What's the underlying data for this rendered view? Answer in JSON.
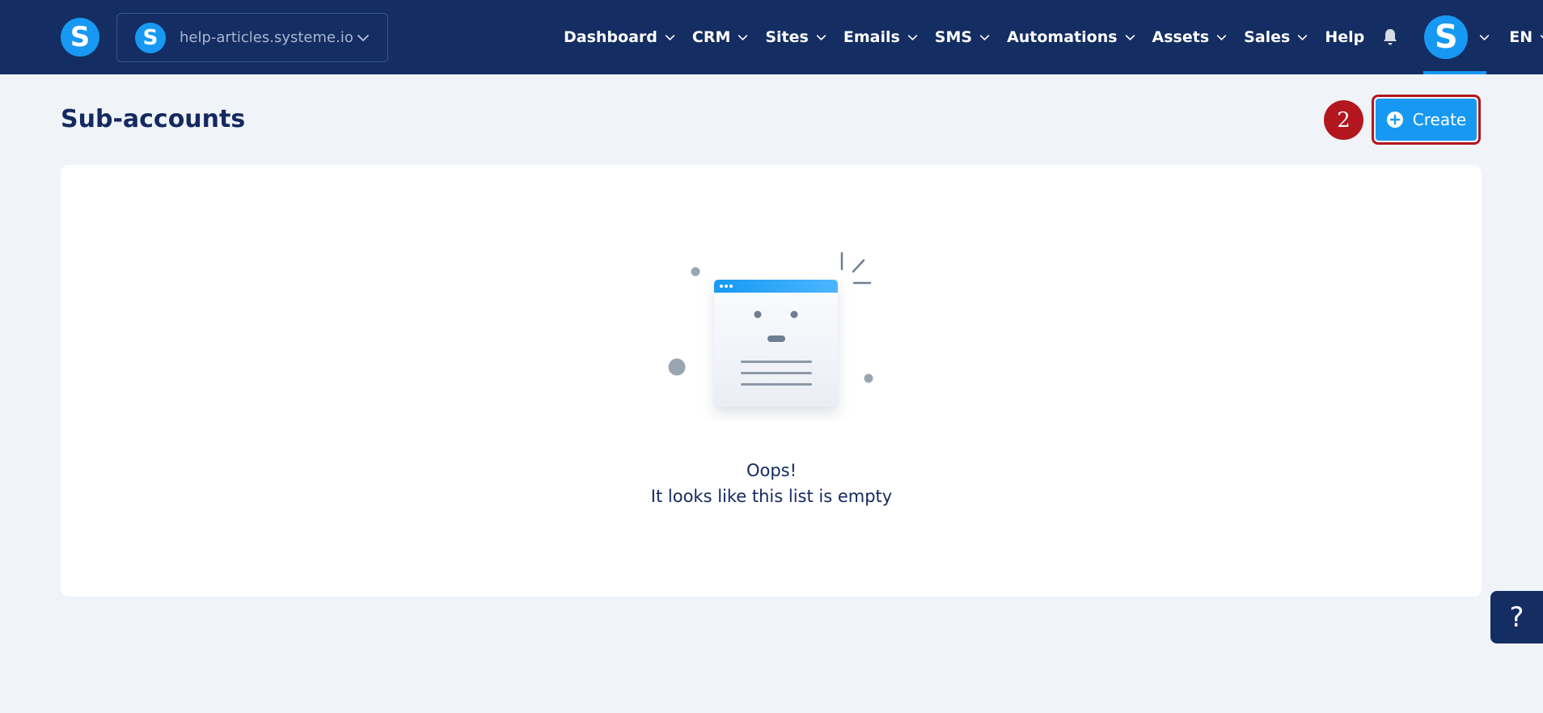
{
  "brand": {
    "logo_letter": "S",
    "accent": "#1799f3",
    "nav_bg": "#142d62"
  },
  "site_switcher": {
    "logo_letter": "S",
    "site_name": "help-articles.systeme.io",
    "icon": "chevron-down-icon"
  },
  "nav": {
    "items": [
      {
        "label": "Dashboard"
      },
      {
        "label": "CRM"
      },
      {
        "label": "Sites"
      },
      {
        "label": "Emails"
      },
      {
        "label": "SMS"
      },
      {
        "label": "Automations"
      },
      {
        "label": "Assets"
      },
      {
        "label": "Sales"
      }
    ],
    "help_label": "Help",
    "bell_icon": "bell-icon",
    "avatar_letter": "S",
    "language": "EN"
  },
  "page": {
    "title": "Sub-accounts",
    "step_number": "2",
    "create_label": "Create",
    "create_icon": "plus-circle-icon",
    "highlight_color": "#b3161e"
  },
  "empty_state": {
    "title": "Oops!",
    "message": "It looks like this list is empty",
    "illustration_icon": "empty-list-illustration"
  },
  "help_fab": {
    "label": "?"
  }
}
